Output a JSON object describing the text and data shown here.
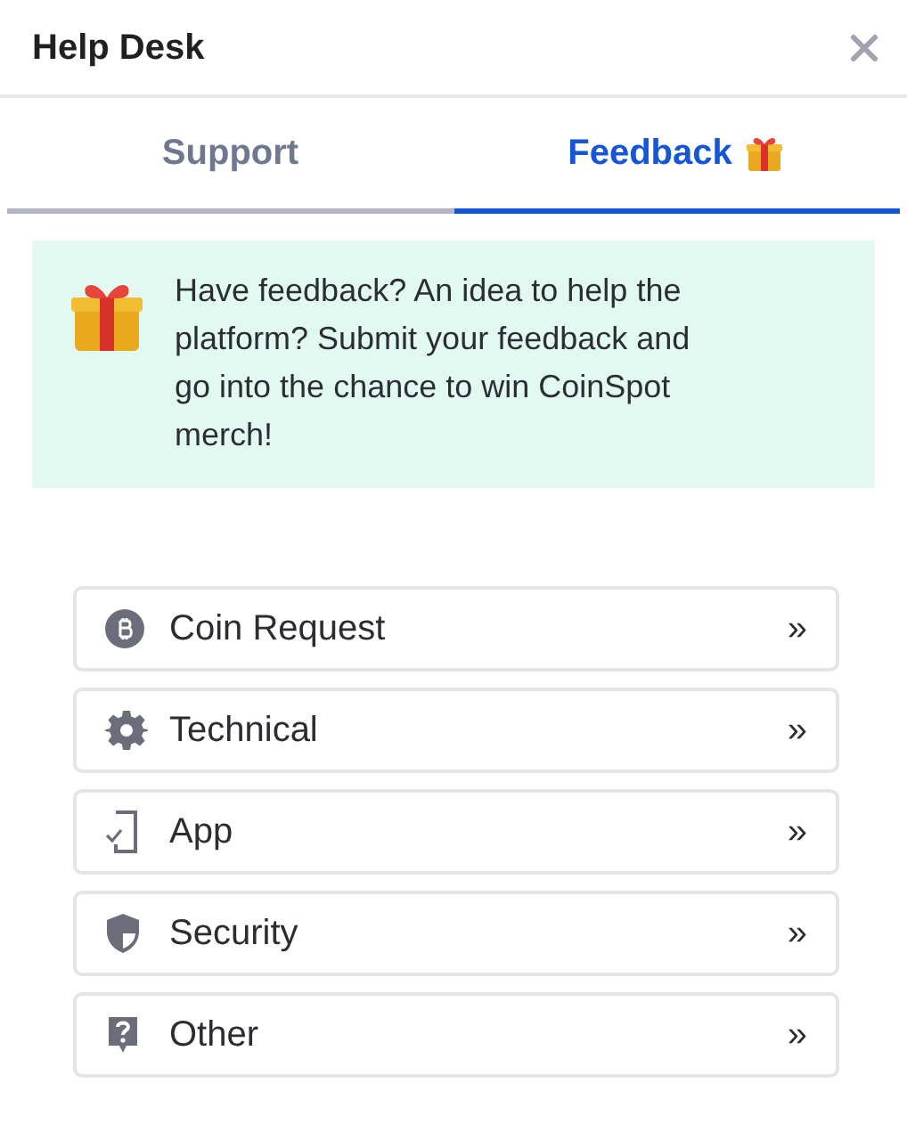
{
  "window": {
    "title": "Help Desk"
  },
  "tabs": [
    {
      "label": "Support",
      "selected": false,
      "gift": false
    },
    {
      "label": "Feedback",
      "selected": true,
      "gift": true
    }
  ],
  "banner": {
    "text": "Have feedback? An idea to help the platform? Submit your feedback and go into the chance to win CoinSpot merch!"
  },
  "categories": [
    {
      "kind": "coin",
      "label": "Coin Request",
      "chevron": "»"
    },
    {
      "kind": "gear",
      "label": "Technical",
      "chevron": "»"
    },
    {
      "kind": "app",
      "label": "App",
      "chevron": "»"
    },
    {
      "kind": "shield",
      "label": "Security",
      "chevron": "»"
    },
    {
      "kind": "question",
      "label": "Other",
      "chevron": "»"
    }
  ]
}
